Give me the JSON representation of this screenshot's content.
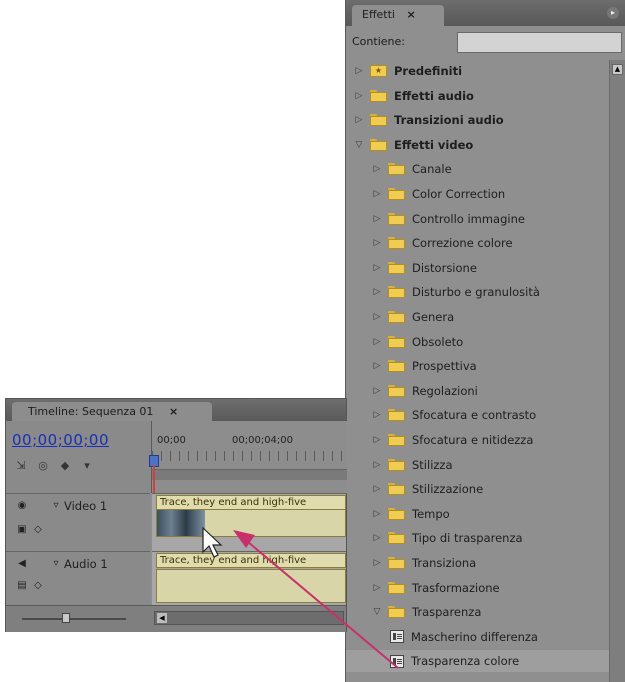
{
  "effects_panel": {
    "tab_label": "Effetti",
    "tab_close": "×",
    "contains_label": "Contiene:",
    "search_value": "",
    "colors": {
      "panel_bg": "#8f8f8f",
      "folder": "#f0cc52",
      "selected_row": "#9e9e9e"
    },
    "items": [
      {
        "label": "Predefiniti",
        "level": 0,
        "expanded": false,
        "bold": true,
        "icon": "star-folder-icon"
      },
      {
        "label": "Effetti audio",
        "level": 0,
        "expanded": false,
        "bold": true,
        "icon": "folder-icon"
      },
      {
        "label": "Transizioni audio",
        "level": 0,
        "expanded": false,
        "bold": true,
        "icon": "folder-icon"
      },
      {
        "label": "Effetti video",
        "level": 0,
        "expanded": true,
        "bold": true,
        "icon": "folder-icon"
      },
      {
        "label": "Canale",
        "level": 1,
        "expanded": false,
        "bold": false,
        "icon": "folder-icon"
      },
      {
        "label": "Color Correction",
        "level": 1,
        "expanded": false,
        "bold": false,
        "icon": "folder-icon"
      },
      {
        "label": "Controllo immagine",
        "level": 1,
        "expanded": false,
        "bold": false,
        "icon": "folder-icon"
      },
      {
        "label": "Correzione colore",
        "level": 1,
        "expanded": false,
        "bold": false,
        "icon": "folder-icon"
      },
      {
        "label": "Distorsione",
        "level": 1,
        "expanded": false,
        "bold": false,
        "icon": "folder-icon"
      },
      {
        "label": "Disturbo e granulosità",
        "level": 1,
        "expanded": false,
        "bold": false,
        "icon": "folder-icon"
      },
      {
        "label": "Genera",
        "level": 1,
        "expanded": false,
        "bold": false,
        "icon": "folder-icon"
      },
      {
        "label": "Obsoleto",
        "level": 1,
        "expanded": false,
        "bold": false,
        "icon": "folder-icon"
      },
      {
        "label": "Prospettiva",
        "level": 1,
        "expanded": false,
        "bold": false,
        "icon": "folder-icon"
      },
      {
        "label": "Regolazioni",
        "level": 1,
        "expanded": false,
        "bold": false,
        "icon": "folder-icon"
      },
      {
        "label": "Sfocatura e contrasto",
        "level": 1,
        "expanded": false,
        "bold": false,
        "icon": "folder-icon"
      },
      {
        "label": "Sfocatura e nitidezza",
        "level": 1,
        "expanded": false,
        "bold": false,
        "icon": "folder-icon"
      },
      {
        "label": "Stilizza",
        "level": 1,
        "expanded": false,
        "bold": false,
        "icon": "folder-icon"
      },
      {
        "label": "Stilizzazione",
        "level": 1,
        "expanded": false,
        "bold": false,
        "icon": "folder-icon"
      },
      {
        "label": "Tempo",
        "level": 1,
        "expanded": false,
        "bold": false,
        "icon": "folder-icon"
      },
      {
        "label": "Tipo di trasparenza",
        "level": 1,
        "expanded": false,
        "bold": false,
        "icon": "folder-icon"
      },
      {
        "label": "Transiziona",
        "level": 1,
        "expanded": false,
        "bold": false,
        "icon": "folder-icon"
      },
      {
        "label": "Trasformazione",
        "level": 1,
        "expanded": false,
        "bold": false,
        "icon": "folder-icon"
      },
      {
        "label": "Trasparenza",
        "level": 1,
        "expanded": true,
        "bold": false,
        "icon": "folder-icon"
      },
      {
        "label": "Mascherino differenza",
        "level": 2,
        "expanded": null,
        "bold": false,
        "icon": "effect-icon"
      },
      {
        "label": "Trasparenza colore",
        "level": 2,
        "expanded": null,
        "bold": false,
        "icon": "effect-icon",
        "selected": true
      }
    ]
  },
  "timeline_panel": {
    "tab_label": "Timeline: Sequenza 01",
    "tab_close": "×",
    "timecode": "00;00;00;00",
    "ruler_labels": [
      "00;00",
      "00;00;04;00"
    ],
    "tracks": {
      "video": {
        "name": "Video 1",
        "clip_title": "Trace, they end and high-five"
      },
      "audio": {
        "name": "Audio 1",
        "clip_title": "Trace, they end and high-five"
      }
    },
    "colors": {
      "timecode": "#1a2fb8",
      "playhead": "#d2403c",
      "clip": "#e0dcae"
    }
  },
  "annotation": {
    "arrow_color": "#c8306c"
  }
}
